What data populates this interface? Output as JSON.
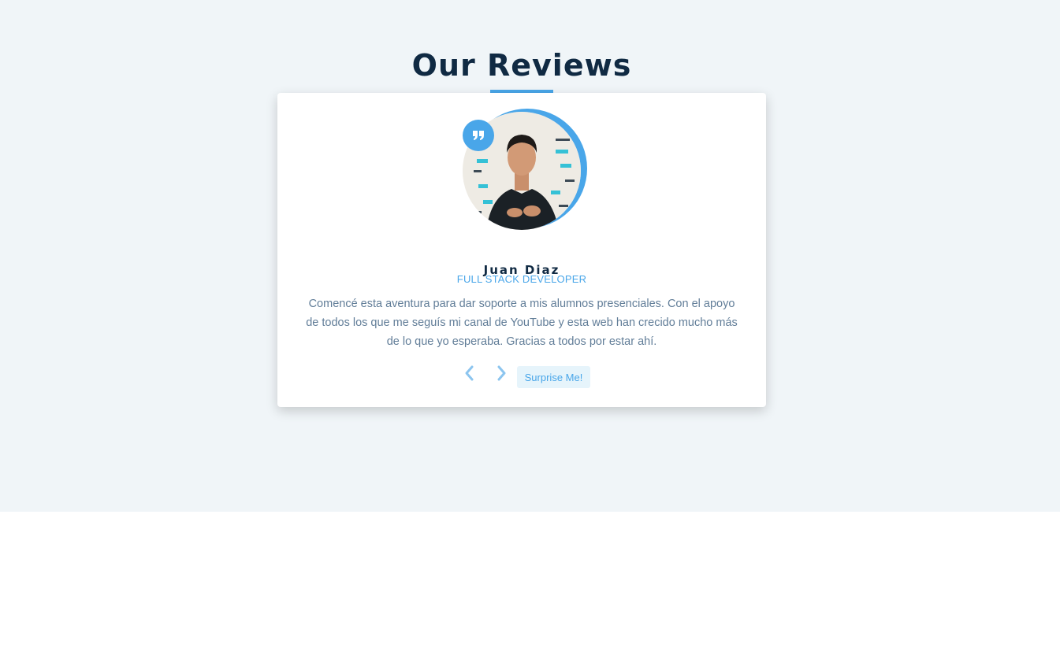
{
  "section": {
    "title": "Our Reviews"
  },
  "review": {
    "name": "Juan Diaz",
    "job": "FULL STACK DEVELOPER",
    "text": "Comencé esta aventura para dar soporte a mis alumnos presenciales. Con el apoyo de todos los que me seguís mi canal de YouTube y esta web han crecido mucho más de lo que yo esperaba. Gracias a todos por estar ahí."
  },
  "buttons": {
    "prev_icon": "chevron-left-icon",
    "next_icon": "chevron-right-icon",
    "random_label": "Surprise Me!"
  },
  "icons": {
    "quote": "quote-right-icon"
  },
  "colors": {
    "accent": "#49a6e9",
    "accent_light": "#e6f4fb",
    "title": "#102a43",
    "text": "#617d98",
    "background": "#f0f5f8"
  }
}
